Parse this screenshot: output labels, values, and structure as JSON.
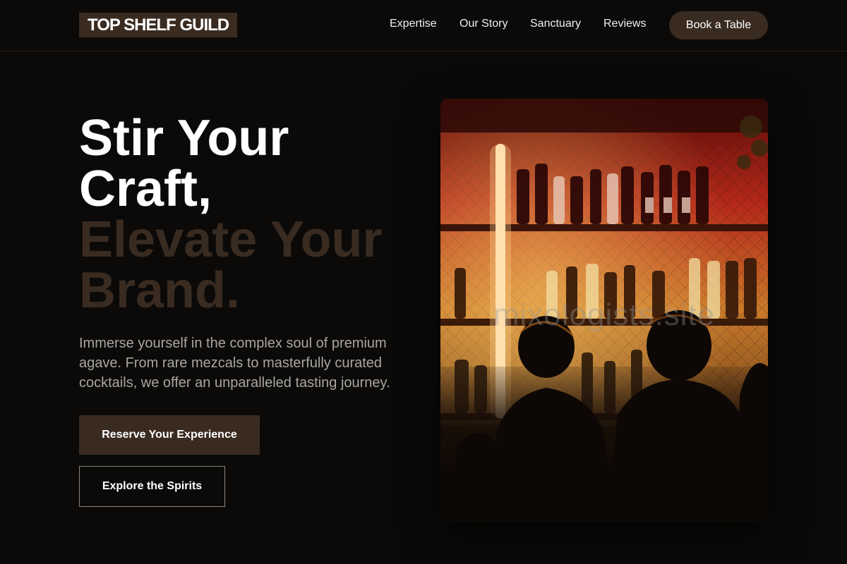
{
  "brand": {
    "logo": "TOP SHELF GUILD"
  },
  "nav": {
    "items": [
      {
        "label": "Expertise"
      },
      {
        "label": "Our Story"
      },
      {
        "label": "Sanctuary"
      },
      {
        "label": "Reviews"
      }
    ],
    "cta_label": "Book a Table"
  },
  "hero": {
    "title_line1": "Stir Your",
    "title_line2": "Craft,",
    "title_line3": "Elevate Your",
    "title_line4": "Brand.",
    "description": "Immerse yourself in the complex soul of premium agave. From rare mezcals to masterfully curated cocktails, we offer an unparalleled tasting journey.",
    "primary_button": "Reserve Your Experience",
    "secondary_button": "Explore the Spirits",
    "image_watermark": "mixologists.site"
  },
  "colors": {
    "background": "#0b0a09",
    "accent": "#3a2b21",
    "text": "#ffffff",
    "muted_text": "#a9a6a3"
  }
}
